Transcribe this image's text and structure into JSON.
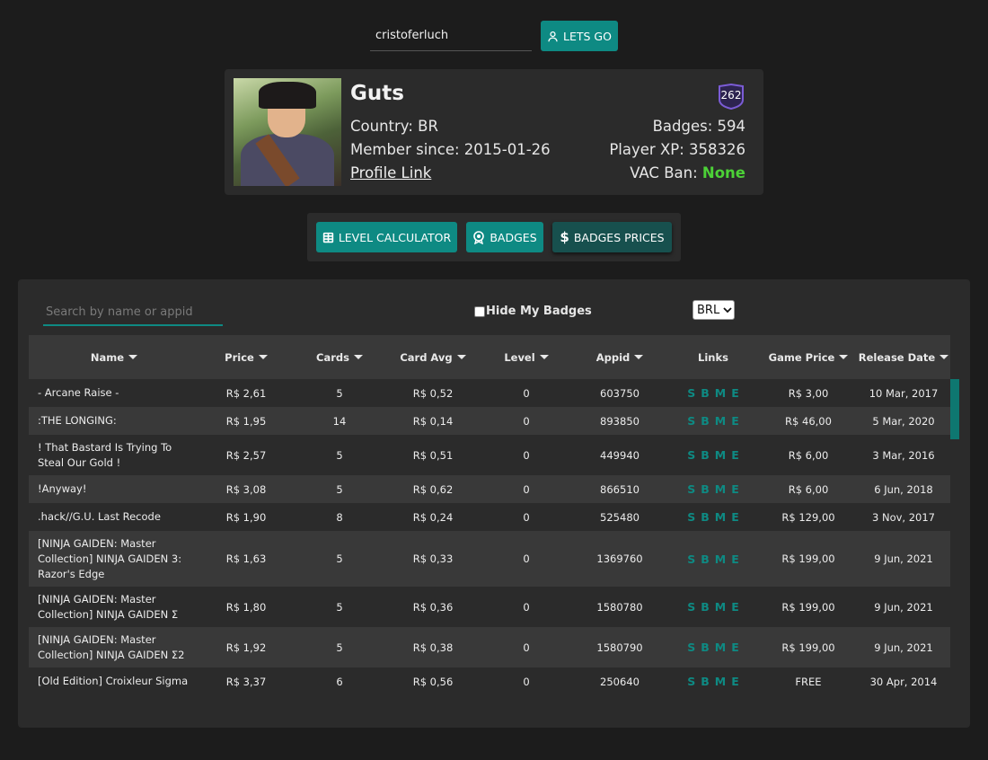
{
  "search": {
    "value": "cristoferluch"
  },
  "lets_go_label": "LETS GO",
  "profile": {
    "name": "Guts",
    "level": "262",
    "country": "Country: BR",
    "member_since": "Member since: 2015-01-26",
    "profile_link": "Profile Link",
    "badges": "Badges: 594",
    "player_xp": "Player XP: 358326",
    "vac_label": "VAC Ban:",
    "vac_value": "None"
  },
  "nav": {
    "level_calculator": "LEVEL CALCULATOR",
    "badges": "BADGES",
    "badges_prices": "BADGES PRICES"
  },
  "filters": {
    "search_placeholder": "Search by name or appid",
    "hide_my_badges": "Hide My Badges",
    "currency": "BRL"
  },
  "table": {
    "headers": [
      "Name",
      "Price",
      "Cards",
      "Card Avg",
      "Level",
      "Appid",
      "Links",
      "Game Price",
      "Release Date"
    ],
    "links": [
      "S",
      "B",
      "M",
      "E"
    ],
    "rows": [
      {
        "name": "- Arcane Raise -",
        "price": "R$ 2,61",
        "cards": "5",
        "avg": "R$ 0,52",
        "level": "0",
        "appid": "603750",
        "game_price": "R$ 3,00",
        "release": "10 Mar, 2017"
      },
      {
        "name": ":THE LONGING:",
        "price": "R$ 1,95",
        "cards": "14",
        "avg": "R$ 0,14",
        "level": "0",
        "appid": "893850",
        "game_price": "R$ 46,00",
        "release": "5 Mar, 2020"
      },
      {
        "name": "! That Bastard Is Trying To Steal Our Gold !",
        "price": "R$ 2,57",
        "cards": "5",
        "avg": "R$ 0,51",
        "level": "0",
        "appid": "449940",
        "game_price": "R$ 6,00",
        "release": "3 Mar, 2016"
      },
      {
        "name": "!Anyway!",
        "price": "R$ 3,08",
        "cards": "5",
        "avg": "R$ 0,62",
        "level": "0",
        "appid": "866510",
        "game_price": "R$ 6,00",
        "release": "6 Jun, 2018"
      },
      {
        "name": ".hack//G.U. Last Recode",
        "price": "R$ 1,90",
        "cards": "8",
        "avg": "R$ 0,24",
        "level": "0",
        "appid": "525480",
        "game_price": "R$ 129,00",
        "release": "3 Nov, 2017"
      },
      {
        "name": "[NINJA GAIDEN: Master Collection] NINJA GAIDEN 3: Razor's Edge",
        "price": "R$ 1,63",
        "cards": "5",
        "avg": "R$ 0,33",
        "level": "0",
        "appid": "1369760",
        "game_price": "R$ 199,00",
        "release": "9 Jun, 2021"
      },
      {
        "name": "[NINJA GAIDEN: Master Collection] NINJA GAIDEN Σ",
        "price": "R$ 1,80",
        "cards": "5",
        "avg": "R$ 0,36",
        "level": "0",
        "appid": "1580780",
        "game_price": "R$ 199,00",
        "release": "9 Jun, 2021"
      },
      {
        "name": "[NINJA GAIDEN: Master Collection] NINJA GAIDEN Σ2",
        "price": "R$ 1,92",
        "cards": "5",
        "avg": "R$ 0,38",
        "level": "0",
        "appid": "1580790",
        "game_price": "R$ 199,00",
        "release": "9 Jun, 2021"
      },
      {
        "name": "[Old Edition] Croixleur Sigma",
        "price": "R$ 3,37",
        "cards": "6",
        "avg": "R$ 0,56",
        "level": "0",
        "appid": "250640",
        "game_price": "FREE",
        "release": "30 Apr, 2014"
      }
    ]
  },
  "colors": {
    "accent": "#0e8a83",
    "vac_ok": "#4cd137",
    "badge_ring": "#7b5cd6"
  }
}
